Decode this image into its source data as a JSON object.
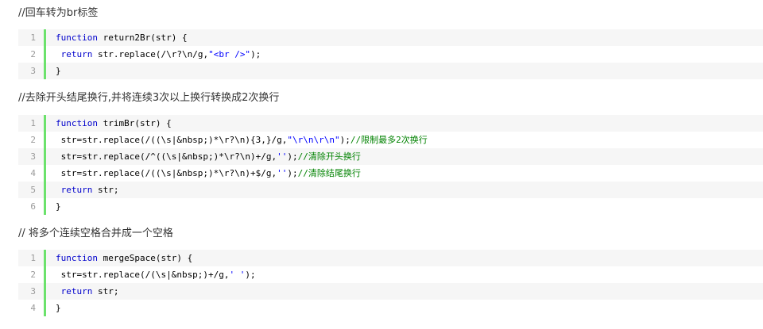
{
  "sections": [
    {
      "heading": "//回车转为br标签",
      "lines": [
        {
          "num": "1",
          "parts": [
            {
              "t": "kw",
              "v": "function"
            },
            {
              "t": "plain",
              "v": " return2Br(str) {"
            }
          ]
        },
        {
          "num": "2",
          "parts": [
            {
              "t": "plain",
              "v": " "
            },
            {
              "t": "kw",
              "v": "return"
            },
            {
              "t": "plain",
              "v": " str.replace(/\\r?\\n/g,"
            },
            {
              "t": "str",
              "v": "\"<br />\""
            },
            {
              "t": "plain",
              "v": ");"
            }
          ]
        },
        {
          "num": "3",
          "parts": [
            {
              "t": "plain",
              "v": "}"
            }
          ]
        }
      ]
    },
    {
      "heading": "//去除开头结尾换行,并将连续3次以上换行转换成2次换行",
      "lines": [
        {
          "num": "1",
          "parts": [
            {
              "t": "kw",
              "v": "function"
            },
            {
              "t": "plain",
              "v": " trimBr(str) {"
            }
          ]
        },
        {
          "num": "2",
          "parts": [
            {
              "t": "plain",
              "v": " str=str.replace(/((\\s|&nbsp;)*\\r?\\n){3,}/g,"
            },
            {
              "t": "str",
              "v": "\"\\r\\n\\r\\n\""
            },
            {
              "t": "plain",
              "v": ");"
            },
            {
              "t": "cmt",
              "v": "//限制最多2次换行"
            }
          ]
        },
        {
          "num": "3",
          "parts": [
            {
              "t": "plain",
              "v": " str=str.replace(/^((\\s|&nbsp;)*\\r?\\n)+/g,"
            },
            {
              "t": "str",
              "v": "''"
            },
            {
              "t": "plain",
              "v": ");"
            },
            {
              "t": "cmt",
              "v": "//清除开头换行"
            }
          ]
        },
        {
          "num": "4",
          "parts": [
            {
              "t": "plain",
              "v": " str=str.replace(/((\\s|&nbsp;)*\\r?\\n)+$/g,"
            },
            {
              "t": "str",
              "v": "''"
            },
            {
              "t": "plain",
              "v": ");"
            },
            {
              "t": "cmt",
              "v": "//清除结尾换行"
            }
          ]
        },
        {
          "num": "5",
          "parts": [
            {
              "t": "plain",
              "v": " "
            },
            {
              "t": "kw",
              "v": "return"
            },
            {
              "t": "plain",
              "v": " str;"
            }
          ]
        },
        {
          "num": "6",
          "parts": [
            {
              "t": "plain",
              "v": "}"
            }
          ]
        }
      ]
    },
    {
      "heading": "// 将多个连续空格合并成一个空格",
      "lines": [
        {
          "num": "1",
          "parts": [
            {
              "t": "kw",
              "v": "function"
            },
            {
              "t": "plain",
              "v": " mergeSpace(str) {"
            }
          ]
        },
        {
          "num": "2",
          "parts": [
            {
              "t": "plain",
              "v": " str=str.replace(/(\\s|&nbsp;)+/g,"
            },
            {
              "t": "str",
              "v": "' '"
            },
            {
              "t": "plain",
              "v": ");"
            }
          ]
        },
        {
          "num": "3",
          "parts": [
            {
              "t": "plain",
              "v": " "
            },
            {
              "t": "kw",
              "v": "return"
            },
            {
              "t": "plain",
              "v": " str;"
            }
          ]
        },
        {
          "num": "4",
          "parts": [
            {
              "t": "plain",
              "v": "}"
            }
          ]
        }
      ]
    }
  ],
  "colors": {
    "keyword": "#0000cc",
    "string": "#0000ff",
    "comment": "#008200",
    "gutter_bar": "#6ce26c",
    "odd_row": "#f6f6f6"
  }
}
